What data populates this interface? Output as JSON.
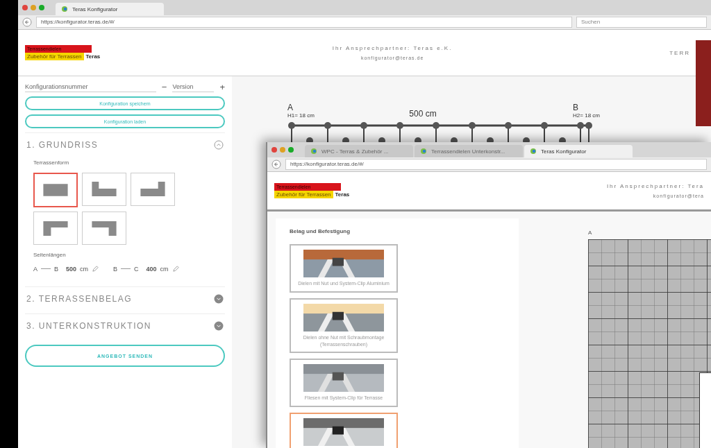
{
  "back_window": {
    "tabs": [
      {
        "title": "Teras Konfigurator",
        "selected": true
      }
    ],
    "url": "https://konfigurator.teras.de/#/",
    "search": {
      "placeholder": "Suchen"
    },
    "logo": {
      "title": "Terrassendielen",
      "tagline": "Zubehör für Terrassen",
      "brand": "Teras"
    },
    "contact": {
      "title": "Ihr Ansprechpartner: Teras e.K.",
      "email": "konfigurator@teras.de"
    },
    "header_right": "TERR",
    "sidebar": {
      "config_label": "Konfigurationsnummer",
      "minus": "−",
      "version_label": "Version",
      "plus": "+",
      "buttons": [
        "Konfiguration speichern",
        "Konfiguration laden"
      ],
      "sections": [
        {
          "title": "1. GRUNDRISS",
          "expanded": true
        },
        {
          "title": "2. TERRASSENBELAG",
          "expanded": false
        },
        {
          "title": "3. UNTERKONSTRUKTION",
          "expanded": false
        }
      ],
      "shape_label": "Terrassenform",
      "shapes": [
        {
          "kind": "rect",
          "selected": true
        },
        {
          "kind": "step-left",
          "selected": false
        },
        {
          "kind": "step-right",
          "selected": false
        },
        {
          "kind": "hook-left",
          "selected": false
        },
        {
          "kind": "hook-right",
          "selected": false
        }
      ],
      "lengths_label": "Seitenlängen",
      "lengths": [
        {
          "from": "A",
          "to": "B",
          "value": "500",
          "unit": "cm"
        },
        {
          "from": "B",
          "to": "C",
          "value": "400",
          "unit": "cm"
        }
      ],
      "submit": "ANGEBOT SENDEN"
    },
    "drawing": {
      "a_label": "A",
      "a_height": "H1= 18 cm",
      "length": "500 cm",
      "b_label": "B",
      "b_height": "H2= 18 cm"
    }
  },
  "front_window": {
    "tabs": [
      {
        "title": "WPC - Terras & Zubehör ...",
        "selected": false
      },
      {
        "title": "Terrassendielen Unterkonstr...",
        "selected": false
      },
      {
        "title": "Teras Konfigurator",
        "selected": true
      }
    ],
    "url": "https://konfigurator.teras.de/#/",
    "logo": {
      "title": "Terrassendielen",
      "tagline": "Zubehör für Terrassen",
      "brand": "Teras"
    },
    "contact": {
      "title": "Ihr Ansprechpartner: Tera",
      "email": "konfigurator@tera"
    },
    "panel_title": "Belag und Befestigung",
    "cards": [
      {
        "caption": "Dielen mit Nut und System-Clip Aluminium",
        "selected": false
      },
      {
        "caption": "Dielen ohne Nut mit Schraubmontage (Terrassenschrauben)",
        "selected": false
      },
      {
        "caption": "Fliesen mit System-Clip für Terrasse",
        "selected": false
      },
      {
        "selected": true
      }
    ],
    "plan": {
      "a_label": "A"
    }
  }
}
